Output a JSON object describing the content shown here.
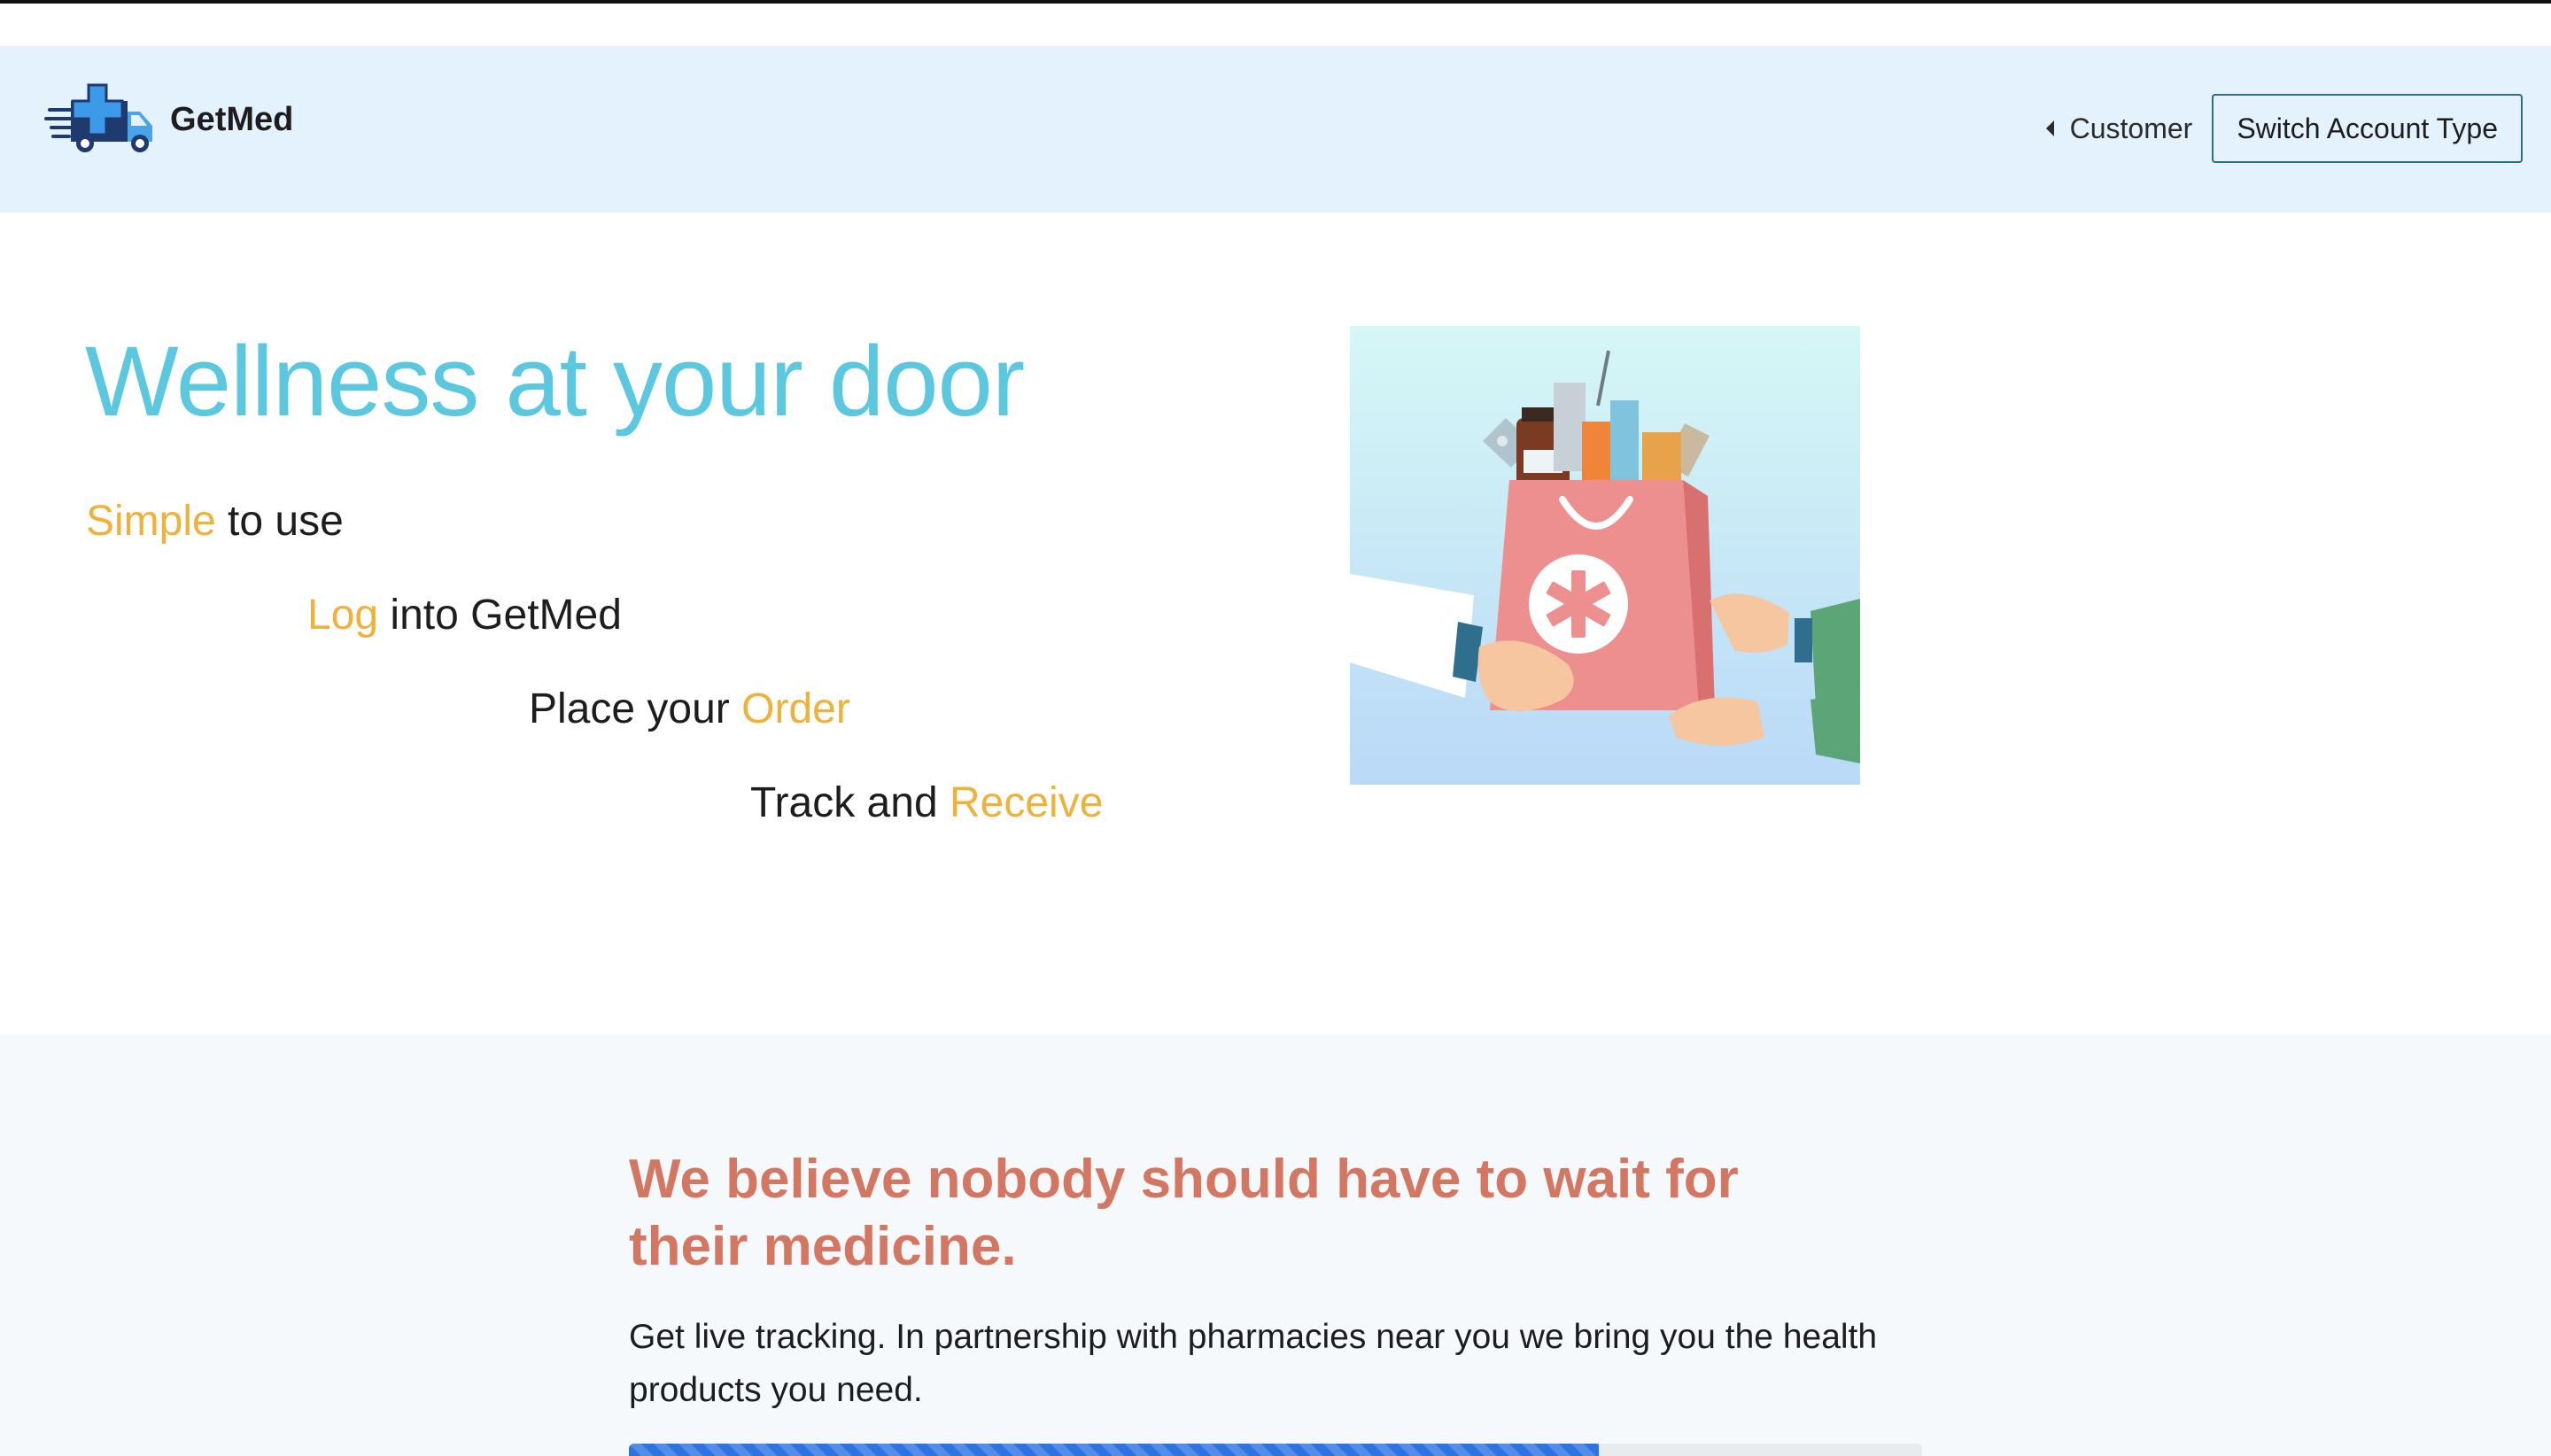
{
  "navbar": {
    "brand_name": "GetMed",
    "account_label": "Customer",
    "switch_button_label": "Switch Account Type"
  },
  "hero": {
    "title": "Wellness at your door",
    "steps": [
      {
        "accent": "Simple",
        "text": " to use"
      },
      {
        "accent": "Log",
        "text": " into GetMed"
      },
      {
        "text": "Place your ",
        "accent": "Order"
      },
      {
        "text": "Track and ",
        "accent": "Receive"
      }
    ]
  },
  "mission": {
    "title": "We believe nobody should have to wait for their medicine.",
    "text": "Get live tracking. In partnership with pharmacies near you we bring you the health products you need.",
    "progress_percent": 75
  },
  "colors": {
    "navbar_bg": "#e3f2fd",
    "hero_title": "#5bc8df",
    "accent": "#f0b13b",
    "mission_title": "#d37763",
    "progress": "#2d74e0"
  },
  "icons": {
    "logo": "delivery-truck-medical-cross-icon",
    "account_caret": "caret-left-icon"
  }
}
